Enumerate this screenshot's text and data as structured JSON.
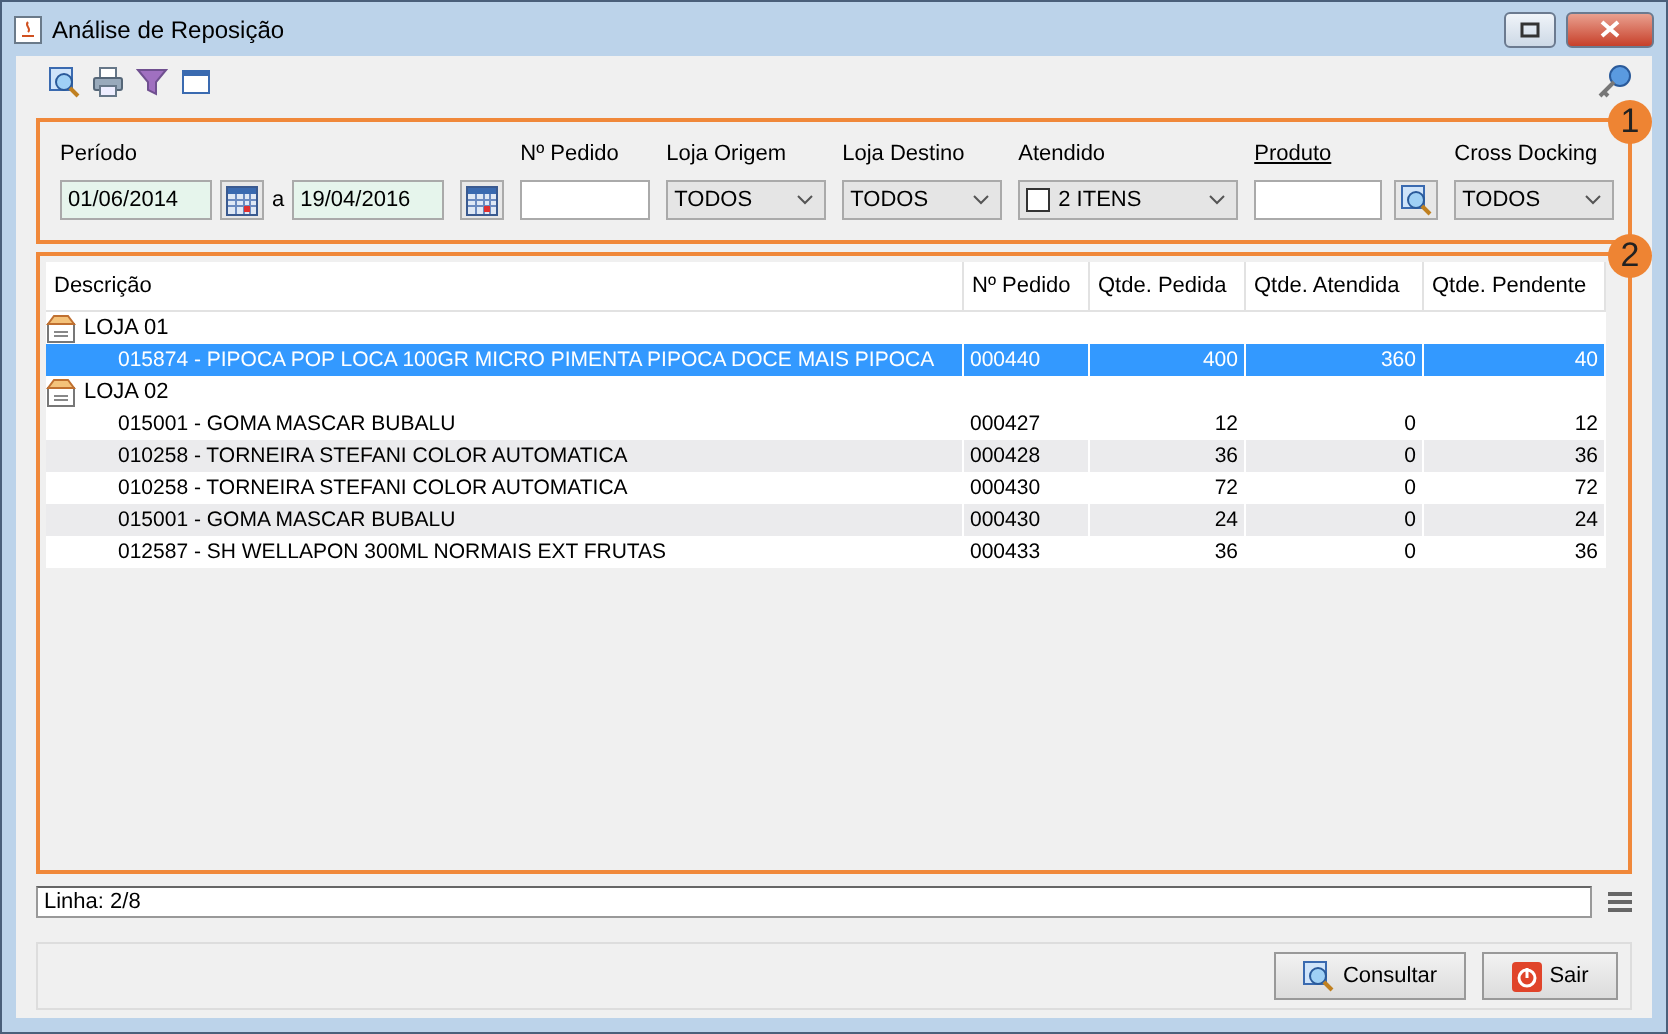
{
  "window": {
    "title": "Análise de Reposição"
  },
  "filters": {
    "periodo_label": "Período",
    "date_from": "01/06/2014",
    "date_sep": "a",
    "date_to": "19/04/2016",
    "pedido_label": "Nº Pedido",
    "origem_label": "Loja Origem",
    "origem_value": "TODOS",
    "destino_label": "Loja Destino",
    "destino_value": "TODOS",
    "atendido_label": "Atendido",
    "atendido_checked": false,
    "atendido_value": "2 ITENS",
    "produto_label": "Produto",
    "cross_label": "Cross Docking",
    "cross_value": "TODOS"
  },
  "callouts": [
    "1",
    "2"
  ],
  "table": {
    "columns": [
      "Descrição",
      "Nº Pedido",
      "Qtde. Pedida",
      "Qtde. Atendida",
      "Qtde. Pendente"
    ],
    "groups": [
      {
        "label": "LOJA 01",
        "children": [
          {
            "cells": [
              "015874 - PIPOCA POP LOCA 100GR MICRO PIMENTA PIPOCA DOCE MAIS PIPOCA",
              "000440",
              "400",
              "360",
              "40"
            ],
            "selected": true
          }
        ]
      },
      {
        "label": "LOJA 02",
        "children": [
          {
            "cells": [
              "015001 - GOMA MASCAR BUBALU",
              "000427",
              "12",
              "0",
              "12"
            ],
            "selected": false
          },
          {
            "cells": [
              "010258 - TORNEIRA STEFANI COLOR AUTOMATICA",
              "000428",
              "36",
              "0",
              "36"
            ],
            "selected": false
          },
          {
            "cells": [
              "010258 - TORNEIRA STEFANI COLOR AUTOMATICA",
              "000430",
              "72",
              "0",
              "72"
            ],
            "selected": false
          },
          {
            "cells": [
              "015001 - GOMA MASCAR BUBALU",
              "000430",
              "24",
              "0",
              "24"
            ],
            "selected": false
          },
          {
            "cells": [
              "012587 - SH WELLAPON 300ML NORMAIS EXT FRUTAS",
              "000433",
              "36",
              "0",
              "36"
            ],
            "selected": false
          }
        ]
      }
    ]
  },
  "status_bar": "Linha: 2/8",
  "buttons": [
    "Consultar",
    "Sair"
  ]
}
